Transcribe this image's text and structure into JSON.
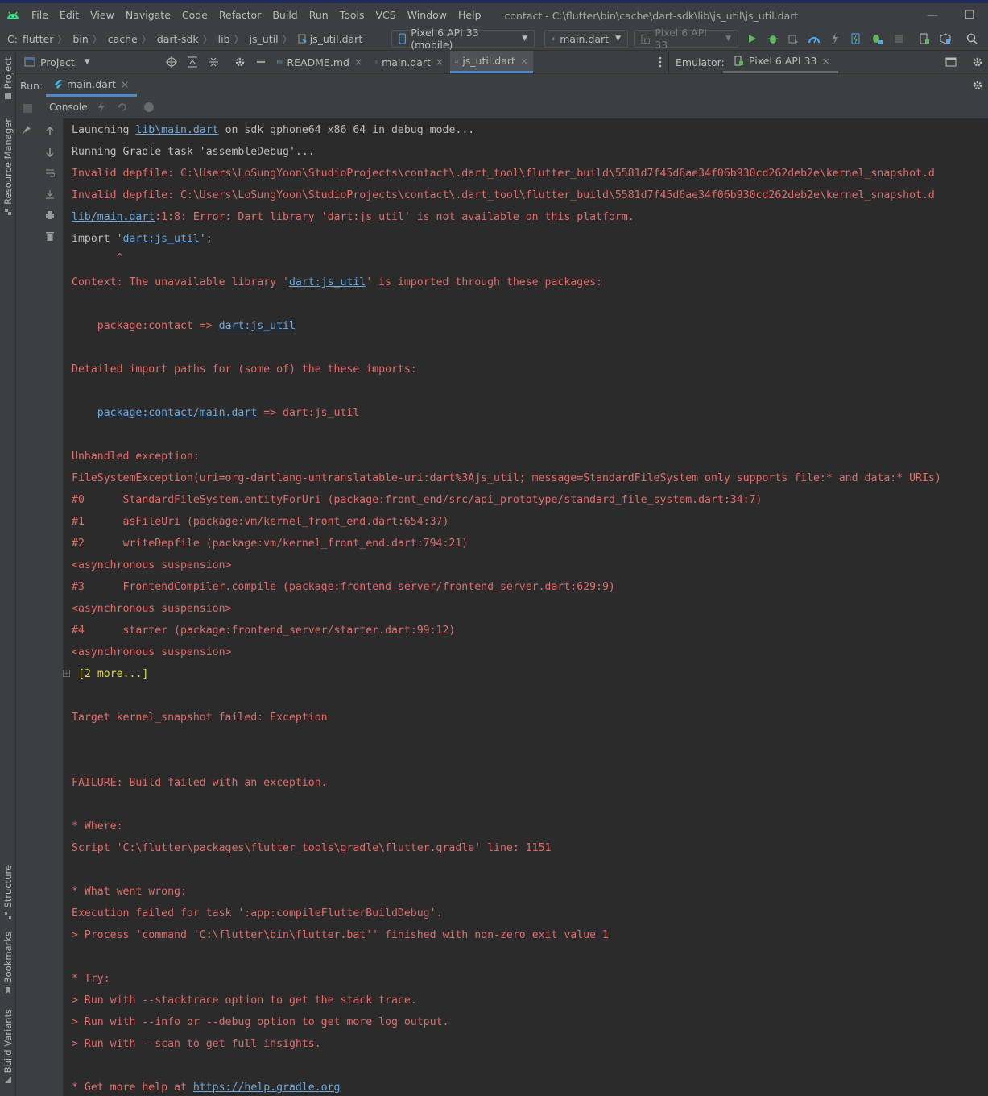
{
  "menubar": {
    "items": [
      {
        "label": "File"
      },
      {
        "label": "Edit"
      },
      {
        "label": "View"
      },
      {
        "label": "Navigate"
      },
      {
        "label": "Code"
      },
      {
        "label": "Refactor"
      },
      {
        "label": "Build"
      },
      {
        "label": "Run"
      },
      {
        "label": "Tools"
      },
      {
        "label": "VCS"
      },
      {
        "label": "Window"
      },
      {
        "label": "Help"
      }
    ],
    "window_title": "contact - C:\\flutter\\bin\\cache\\dart-sdk\\lib\\js_util\\js_util.dart",
    "minimize": "—",
    "maximize": "☐"
  },
  "navbar": {
    "breadcrumbs": [
      "C:",
      "flutter",
      "bin",
      "cache",
      "dart-sdk",
      "lib",
      "js_util",
      "js_util.dart"
    ],
    "sep": "〉",
    "device_combo": "Pixel 6 API 33 (mobile)",
    "config_combo": "main.dart",
    "target_combo": "Pixel 6 API 33"
  },
  "tabrow": {
    "project_label": "Project",
    "tabs": [
      {
        "label": "README.md"
      },
      {
        "label": "main.dart"
      },
      {
        "label": "js_util.dart"
      }
    ],
    "close": "×",
    "emulator_label": "Emulator:",
    "emulator_device": "Pixel 6 API 33"
  },
  "run": {
    "label": "Run:",
    "tab": "main.dart",
    "console_label": "Console"
  },
  "sidebar": {
    "top": [
      "Project",
      "Resource Manager"
    ],
    "bottom": [
      "Structure",
      "Bookmarks",
      "Build Variants"
    ]
  },
  "console": {
    "l1a": "Launching ",
    "l1b": "lib\\main.dart",
    "l1c": " on sdk gphone64 x86 64 in debug mode...",
    "l2": "Running Gradle task 'assembleDebug'...",
    "l3": "Invalid depfile: C:\\Users\\LoSungYoon\\StudioProjects\\contact\\.dart_tool\\flutter_build\\5581d7f45d6ae34f06b930cd262deb2e\\kernel_snapshot.d",
    "l4": "Invalid depfile: C:\\Users\\LoSungYoon\\StudioProjects\\contact\\.dart_tool\\flutter_build\\5581d7f45d6ae34f06b930cd262deb2e\\kernel_snapshot.d",
    "l5a": "lib/main.dart",
    "l5b": ":1:8: Error: Dart library 'dart:js_util' is not available on this platform.",
    "l6a": "import '",
    "l6b": "dart:js_util",
    "l6c": "';",
    "l7": "       ^",
    "l8a": "Context: The unavailable library '",
    "l8b": "dart:js_util",
    "l8c": "' is imported through these packages:",
    "l9a": "    package:contact => ",
    "l9b": "dart:js_util",
    "l10": "Detailed import paths for (some of) the these imports:",
    "l11a": "    ",
    "l11b": "package:contact/main.dart",
    "l11c": " => dart:js_util",
    "l12": "Unhandled exception:",
    "l13": "FileSystemException(uri=org-dartlang-untranslatable-uri:dart%3Ajs_util; message=StandardFileSystem only supports file:* and data:* URIs)",
    "l14": "#0      StandardFileSystem.entityForUri (package:front_end/src/api_prototype/standard_file_system.dart:34:7)",
    "l15": "#1      asFileUri (package:vm/kernel_front_end.dart:654:37)",
    "l16": "#2      writeDepfile (package:vm/kernel_front_end.dart:794:21)",
    "l17": "<asynchronous suspension>",
    "l18": "#3      FrontendCompiler.compile (package:frontend_server/frontend_server.dart:629:9)",
    "l19": "<asynchronous suspension>",
    "l20": "#4      starter (package:frontend_server/starter.dart:99:12)",
    "l21": "<asynchronous suspension>",
    "l22": "[2 more...]",
    "l23": "Target kernel_snapshot failed: Exception",
    "l24": "FAILURE: Build failed with an exception.",
    "l25": "* Where:",
    "l26": "Script 'C:\\flutter\\packages\\flutter_tools\\gradle\\flutter.gradle' line: 1151",
    "l27": "* What went wrong:",
    "l28": "Execution failed for task ':app:compileFlutterBuildDebug'.",
    "l29": "> Process 'command 'C:\\flutter\\bin\\flutter.bat'' finished with non-zero exit value 1",
    "l30": "* Try:",
    "l31": "> Run with --stacktrace option to get the stack trace.",
    "l32": "> Run with --info or --debug option to get more log output.",
    "l33": "> Run with --scan to get full insights.",
    "l34a": "* Get more help at ",
    "l34b": "https://help.gradle.org"
  },
  "colors": {
    "error_red": "#e06c6c",
    "link_blue": "#6fa8dc",
    "fold_yellow": "#e0d94f",
    "accent": "#4a88c7"
  }
}
